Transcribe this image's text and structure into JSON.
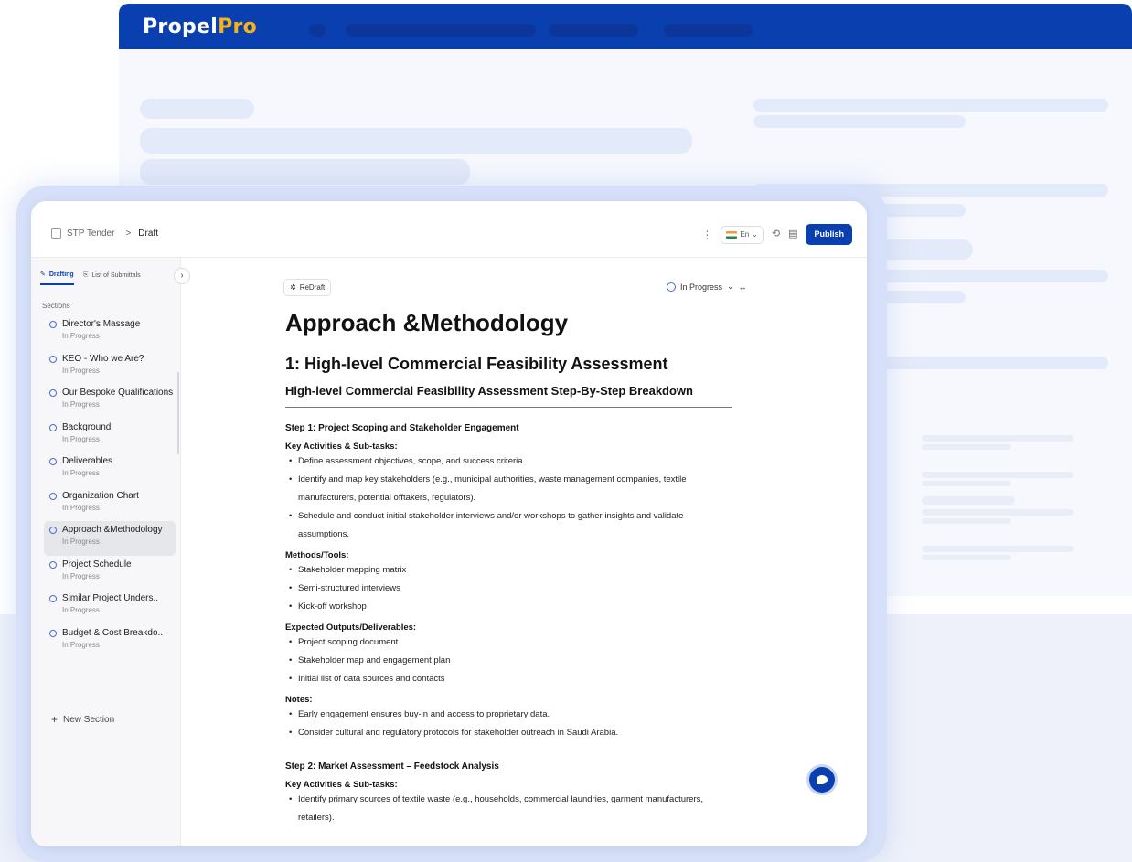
{
  "brand": {
    "name_a": "Propel",
    "name_b": "Pro"
  },
  "colors": {
    "primary": "#0a3fb0",
    "accent": "#f6b21a"
  },
  "topbar": {
    "breadcrumb_root": "STP Tender",
    "breadcrumb_sep": ">",
    "breadcrumb_current": "Draft",
    "language": "En",
    "publish_label": "Publish"
  },
  "sidebar": {
    "tabs": [
      {
        "label": "Drafting"
      },
      {
        "label": "List of Submittals"
      }
    ],
    "sections_label": "Sections",
    "items": [
      {
        "title": "Director's Massage",
        "status": "In Progress"
      },
      {
        "title": "KEO - Who we Are?",
        "status": "In Progress"
      },
      {
        "title": "Our Bespoke Qualifications",
        "status": "In Progress"
      },
      {
        "title": "Background",
        "status": "In Progress"
      },
      {
        "title": "Deliverables",
        "status": "In Progress"
      },
      {
        "title": "Organization Chart",
        "status": "In Progress"
      },
      {
        "title": "Approach &Methodology",
        "status": "In Progress"
      },
      {
        "title": "Project Schedule",
        "status": "In Progress"
      },
      {
        "title": "Similar Project Unders..",
        "status": "In Progress"
      },
      {
        "title": "Budget & Cost Breakdo..",
        "status": "In Progress"
      }
    ],
    "new_section_label": "New Section"
  },
  "main": {
    "redraft_label": "ReDraft",
    "status_label": "In Progress",
    "title": "Approach &Methodology",
    "heading": "1: High-level Commercial Feasibility Assessment",
    "subheading": "High-level Commercial Feasibility Assessment Step-By-Step Breakdown",
    "step1": {
      "title": "Step 1: Project Scoping and Stakeholder Engagement",
      "activities_label": "Key Activities & Sub-tasks:",
      "activities": [
        "Define assessment objectives, scope, and success criteria.",
        "Identify and map key stakeholders (e.g., municipal authorities, waste management companies, textile manufacturers, potential offtakers, regulators).",
        "Schedule and conduct initial stakeholder interviews and/or workshops to gather insights and validate assumptions."
      ],
      "methods_label": "Methods/Tools:",
      "methods": [
        "Stakeholder mapping matrix",
        "Semi-structured interviews",
        "Kick-off workshop"
      ],
      "outputs_label": "Expected Outputs/Deliverables:",
      "outputs": [
        "Project scoping document",
        "Stakeholder map and engagement plan",
        "Initial list of data sources and contacts"
      ],
      "notes_label": "Notes:",
      "notes": [
        "Early engagement ensures buy-in and access to proprietary data.",
        "Consider cultural and regulatory protocols for stakeholder outreach in Saudi Arabia."
      ]
    },
    "step2": {
      "title": "Step 2: Market Assessment – Feedstock Analysis",
      "activities_label": "Key Activities & Sub-tasks:",
      "activities": [
        "Identify primary sources of textile waste (e.g., households, commercial laundries, garment manufacturers, retailers)."
      ]
    }
  }
}
